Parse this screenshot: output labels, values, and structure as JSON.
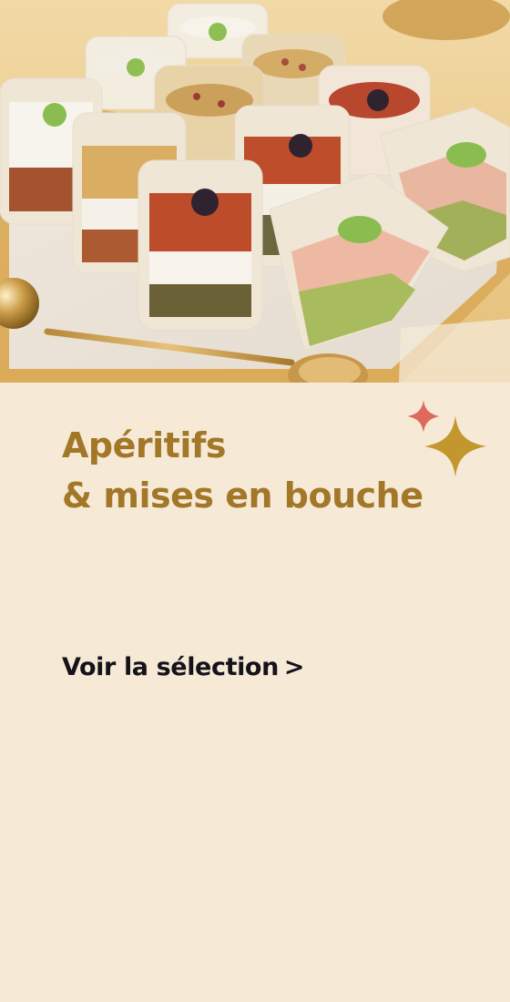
{
  "hero": {
    "title_line1": "Apéritifs",
    "title_line2": "& mises en bouche",
    "image_alt": "Verrines apéritives sur un plateau"
  },
  "cta": {
    "label": "Voir la sélection",
    "chevron": ">"
  },
  "colors": {
    "background": "#f6ead6",
    "title": "#a27728",
    "cta_text": "#15121a",
    "sparkle_gold": "#c4962e",
    "sparkle_red": "#de6a5a"
  },
  "icons": [
    "sparkle-icon",
    "chevron-right-icon"
  ]
}
